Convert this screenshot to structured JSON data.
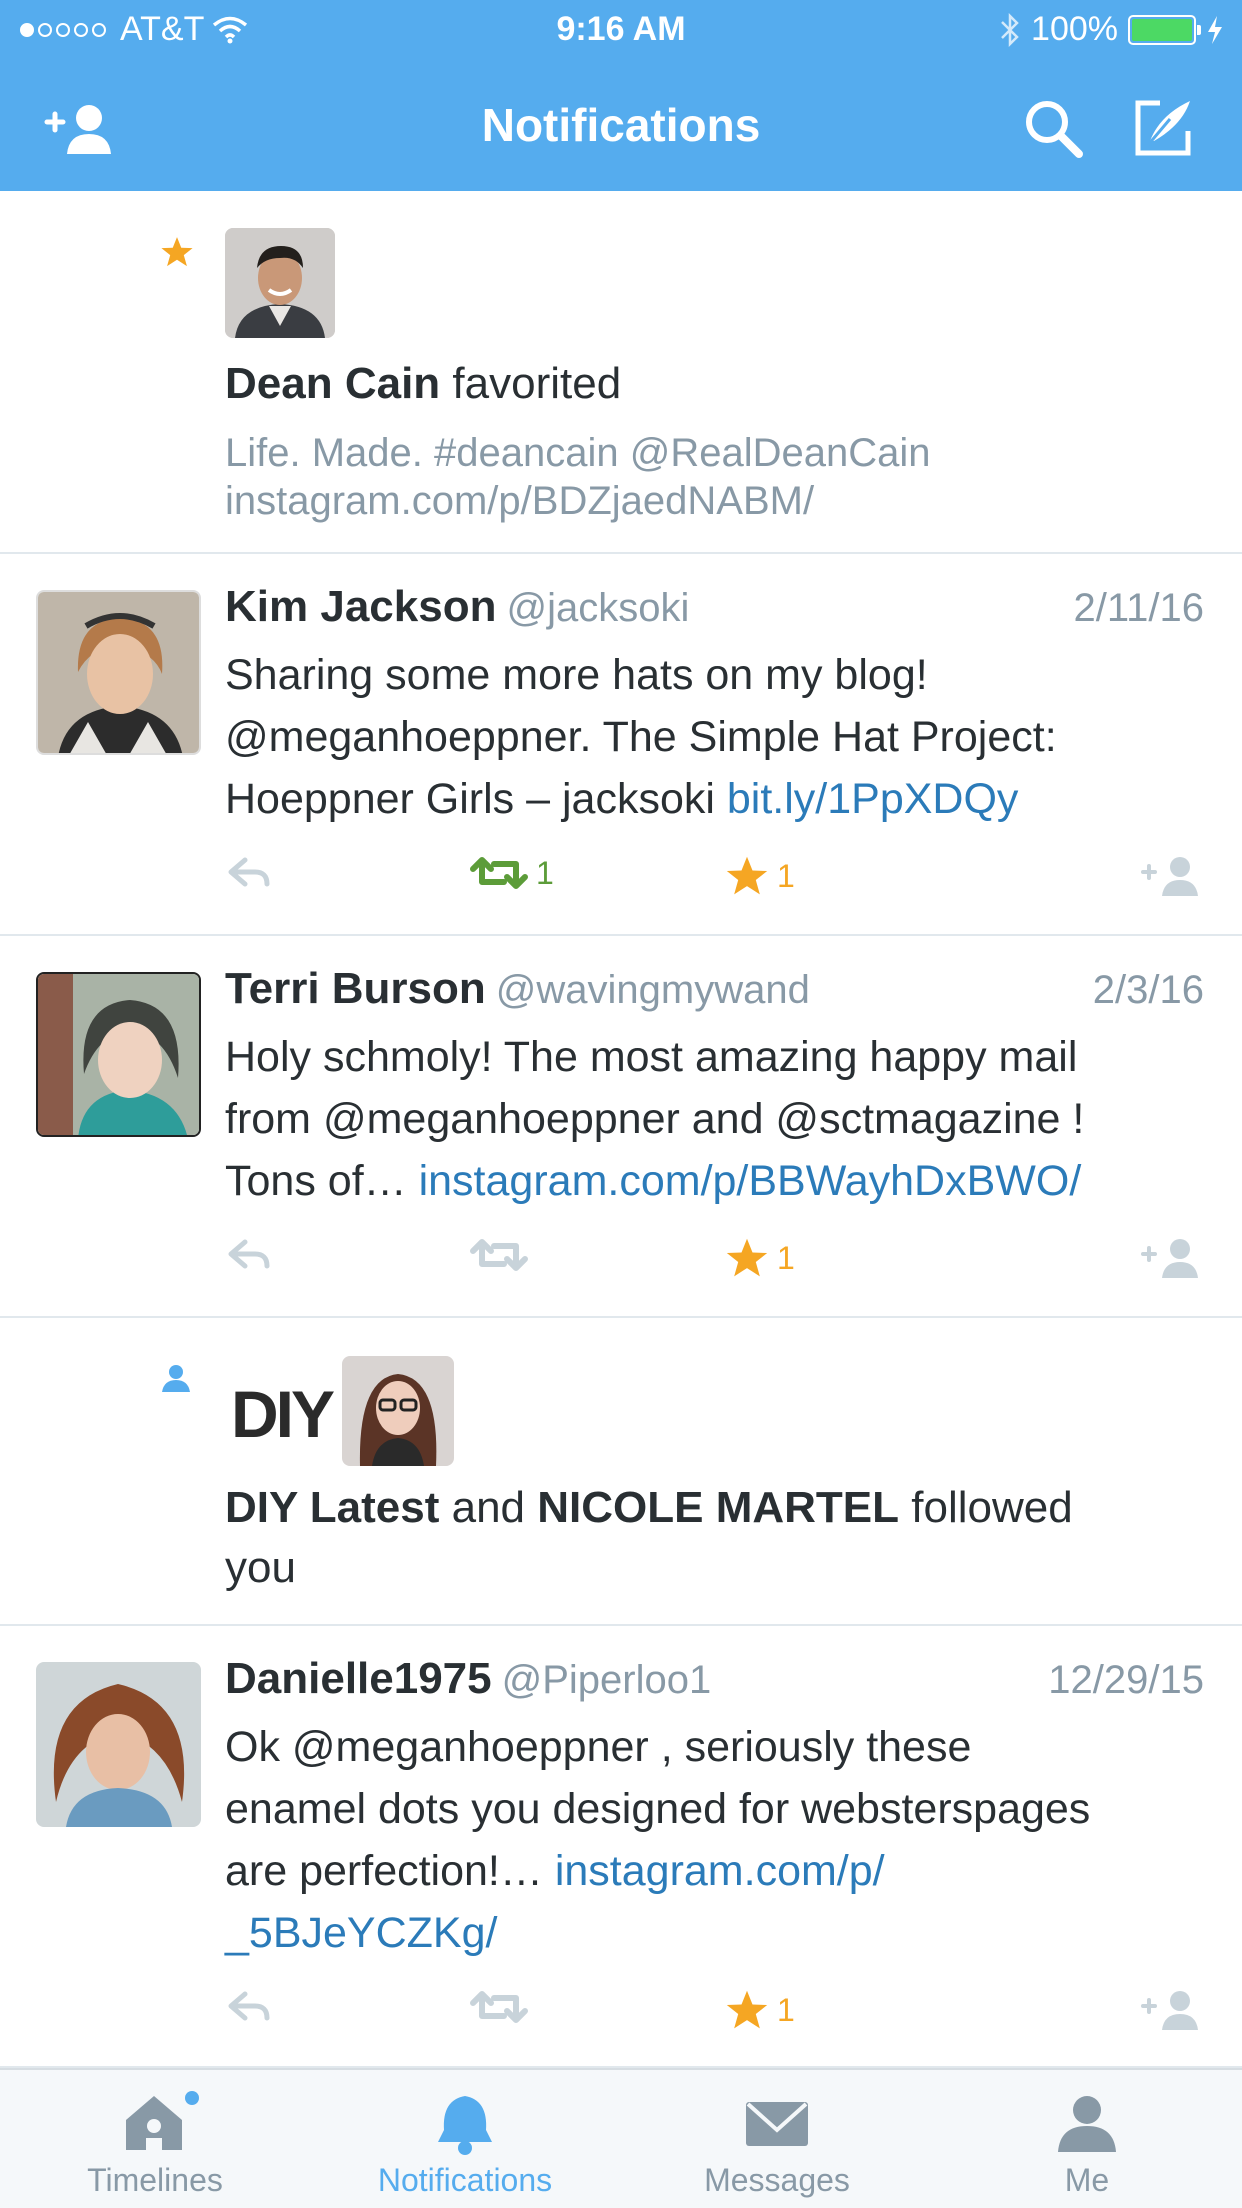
{
  "status_bar": {
    "carrier": "AT&T",
    "time": "9:16 AM",
    "battery": "100%"
  },
  "nav": {
    "title": "Notifications"
  },
  "notifications": [
    {
      "type": "favorite",
      "actor": "Dean Cain",
      "verb": "favorited",
      "tweet_text": "Life. Made. #deancain @RealDeanCain",
      "tweet_link": "instagram.com/p/BDZjaedNABM/"
    },
    {
      "type": "mention",
      "name": "Kim Jackson",
      "handle": "@jacksoki",
      "date": "2/11/16",
      "text_line1": "Sharing some more hats on my blog!",
      "text_line2": "@meganhoeppner. The Simple Hat Project:",
      "text_line3": "Hoeppner Girls – jacksoki ",
      "link": "bit.ly/1PpXDQy",
      "retweets": "1",
      "favorites": "1"
    },
    {
      "type": "mention",
      "name": "Terri Burson",
      "handle": "@wavingmywand",
      "date": "2/3/16",
      "text_line1": "Holy schmoly!  The most amazing happy mail",
      "text_line2": "from @meganhoeppner and @sctmagazine !",
      "text_line3": "Tons of… ",
      "link": "instagram.com/p/BBWayhDxBWO/",
      "favorites": "1"
    },
    {
      "type": "follow",
      "actor1": "DIY Latest",
      "connector": "and",
      "actor2": "NICOLE MARTEL",
      "verb": "followed",
      "verb_line2": "you",
      "diy_logo": "DIY"
    },
    {
      "type": "mention",
      "name": "Danielle1975",
      "handle": "@Piperloo1",
      "date": "12/29/15",
      "text_line1": "Ok @meganhoeppner , seriously these",
      "text_line2": "enamel dots you designed for websterspages",
      "text_line3": "are perfection!… ",
      "link_part1": "instagram.com/p/",
      "link_part2": "_5BJeYCZKg/",
      "favorites": "1"
    }
  ],
  "tabs": [
    {
      "label": "Timelines",
      "icon": "home-icon"
    },
    {
      "label": "Notifications",
      "icon": "bell-icon"
    },
    {
      "label": "Messages",
      "icon": "envelope-icon"
    },
    {
      "label": "Me",
      "icon": "person-icon"
    }
  ],
  "colors": {
    "brand_blue": "#55acee",
    "link_blue": "#2b7bb9",
    "favorite_orange": "#f5a623",
    "retweet_green": "#5c9c39",
    "muted_gray": "#8899a6"
  }
}
